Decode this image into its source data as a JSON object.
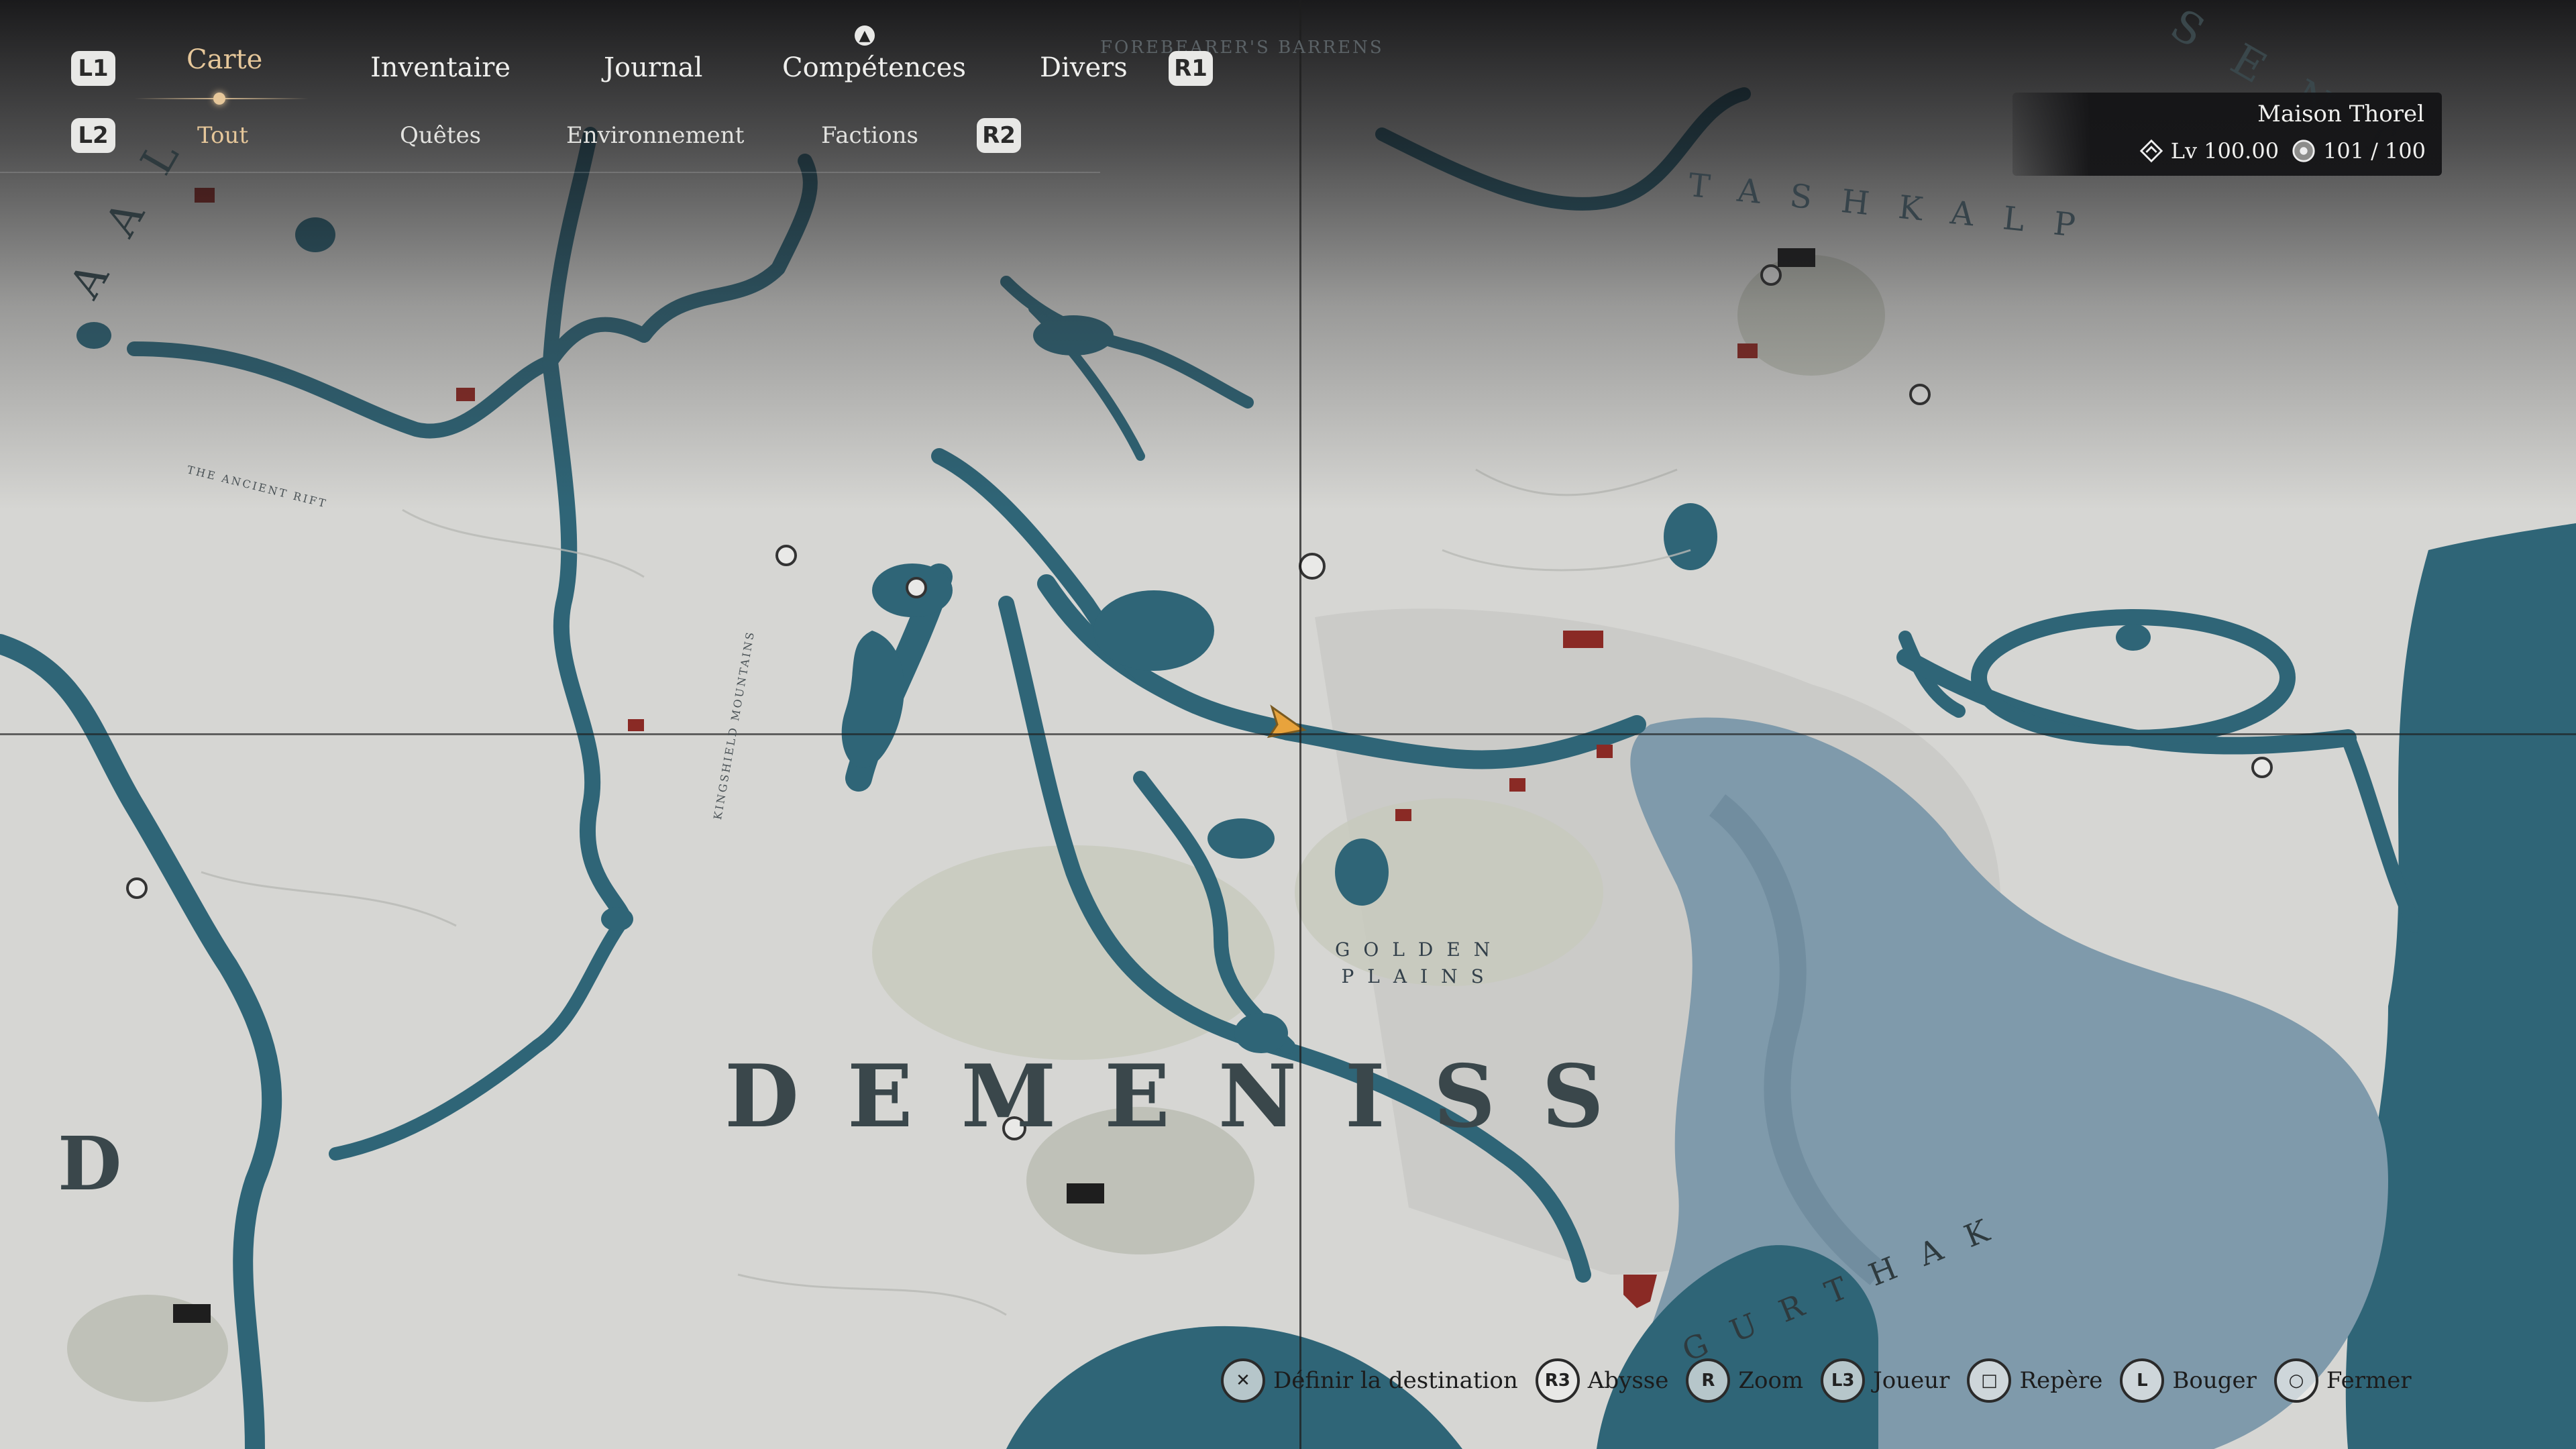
{
  "nav": {
    "left_bumper": "L1",
    "right_bumper": "R1",
    "left_trigger": "L2",
    "right_trigger": "R2",
    "tabs": [
      {
        "label": "Carte",
        "active": true
      },
      {
        "label": "Inventaire",
        "active": false
      },
      {
        "label": "Journal",
        "active": false
      },
      {
        "label": "Compétences",
        "active": false
      },
      {
        "label": "Divers",
        "active": false
      }
    ],
    "subtabs": [
      {
        "label": "Tout",
        "active": true
      },
      {
        "label": "Quêtes",
        "active": false
      },
      {
        "label": "Environnement",
        "active": false
      },
      {
        "label": "Factions",
        "active": false
      }
    ],
    "accent_color": "#e6c79a",
    "skill_point_icon": "up-arrow-icon"
  },
  "player": {
    "house": "Maison Thorel",
    "level_label": "Lv",
    "level_value": "100.00",
    "resource_current": "101",
    "resource_separator": "/",
    "resource_max": "100"
  },
  "map": {
    "regions": {
      "main": "DEMENISS",
      "plains_line1": "GOLDEN",
      "plains_line2": "PLAINS",
      "north_east": "TASHKALP",
      "west_partial": "D",
      "rift": "THE ANCIENT RIFT",
      "mountains": "KINGSHIELD MOUNTAINS",
      "south_east": "GURTHAK",
      "north_partial": "FOREBEARER'S BARRENS",
      "edge_top_right": "SENT",
      "edge_top_left": "AAL"
    },
    "colors": {
      "land": "#d6d6d3",
      "water": "#2f6577",
      "shallow": "#7f9aab",
      "marker": "#8a2a25",
      "player": "#e8a33c"
    }
  },
  "hints": [
    {
      "glyph": "✕",
      "label": "Définir la destination",
      "icon": "cross-button-icon"
    },
    {
      "glyph": "R3",
      "label": "Abysse",
      "icon": "r3-button-icon"
    },
    {
      "glyph": "R",
      "label": "Zoom",
      "icon": "right-stick-icon"
    },
    {
      "glyph": "L3",
      "label": "Joueur",
      "icon": "l3-button-icon"
    },
    {
      "glyph": "□",
      "label": "Repère",
      "icon": "square-button-icon"
    },
    {
      "glyph": "L",
      "label": "Bouger",
      "icon": "left-stick-icon"
    },
    {
      "glyph": "○",
      "label": "Fermer",
      "icon": "circle-button-icon"
    }
  ]
}
